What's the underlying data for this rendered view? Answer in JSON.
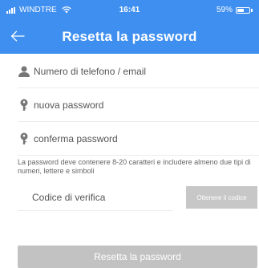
{
  "status_bar": {
    "carrier": "WINDTRE",
    "time": "16:41",
    "battery": "59%",
    "battery_level": 0.59
  },
  "header": {
    "title": "Resetta la password",
    "back_icon": "arrow-left-icon"
  },
  "form": {
    "account": {
      "placeholder": "Numero di telefono / email",
      "value": "",
      "icon": "person-icon"
    },
    "new_password": {
      "placeholder": "nuova password",
      "value": "",
      "icon": "key-icon"
    },
    "confirm_password": {
      "placeholder": "conferma password",
      "value": "",
      "icon": "key-icon"
    },
    "hint": "La password deve contenere 8-20 caratteri e includere almeno due tipi di numeri, lettere e simboli",
    "verification_code": {
      "placeholder": "Codice di verifica",
      "value": ""
    },
    "get_code_label": "Ottenere il codice",
    "submit_label": "Resetta la password"
  },
  "colors": {
    "header_bg": "#3f8ff0",
    "icon_gray": "#777777",
    "disabled_button": "#c2c2c2"
  }
}
